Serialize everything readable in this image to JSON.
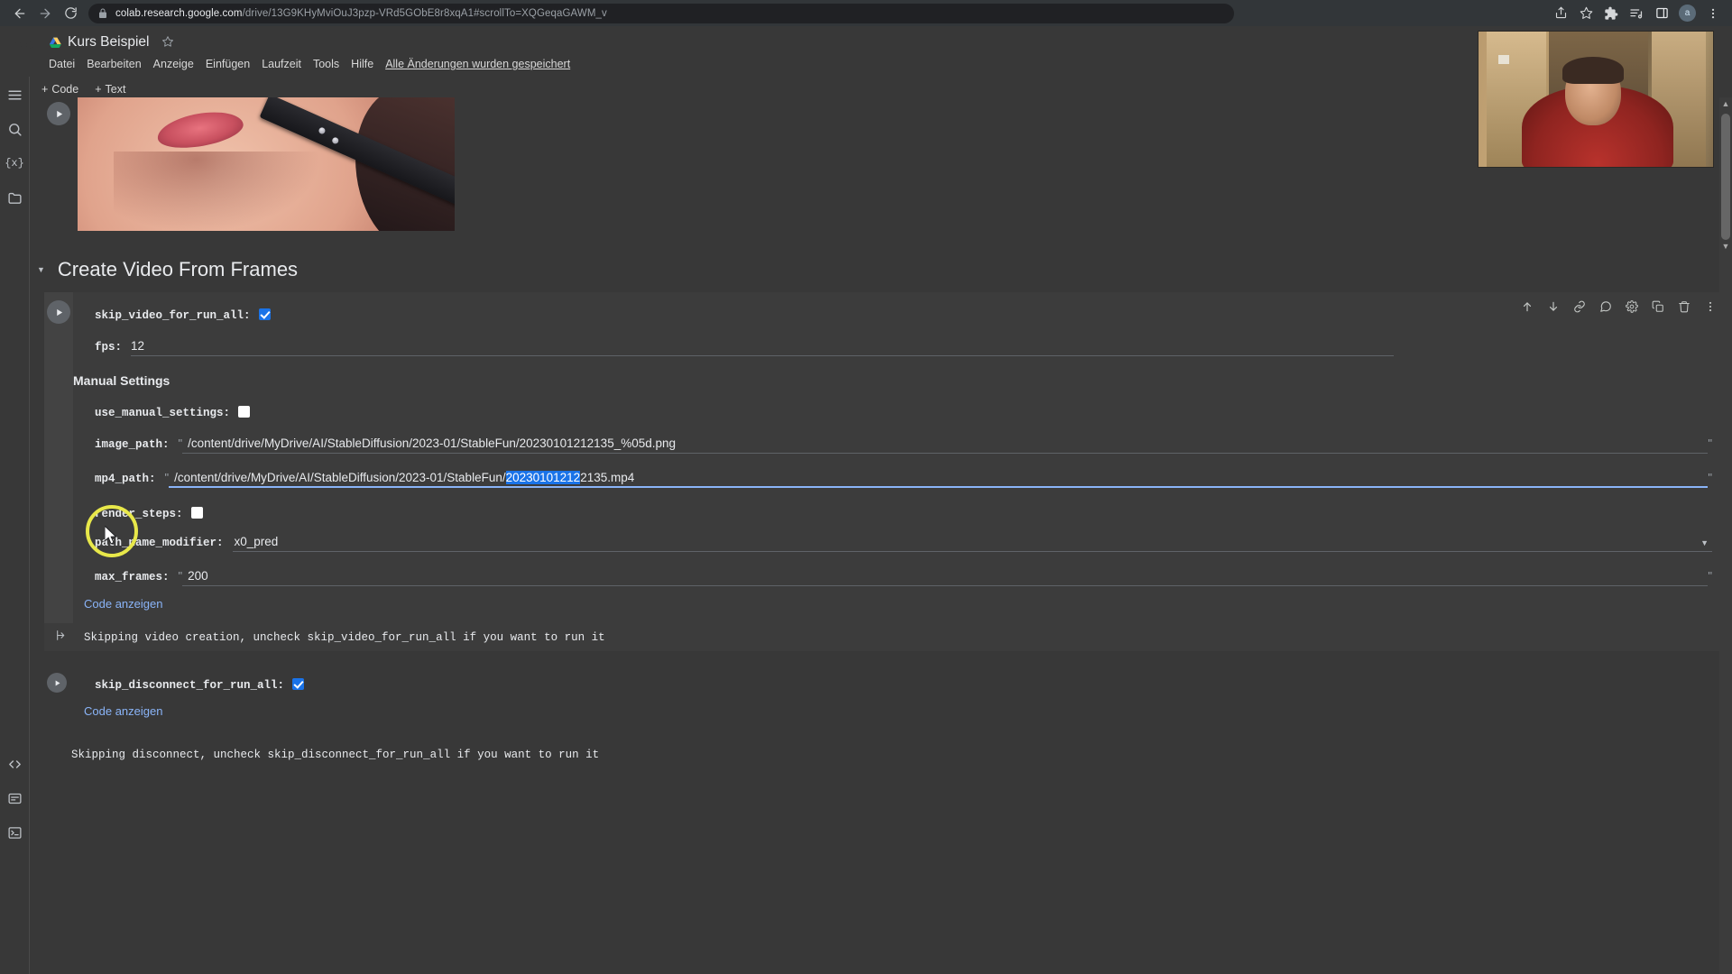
{
  "browser": {
    "back_icon": "back-arrow-icon",
    "forward_icon": "forward-arrow-icon",
    "reload_icon": "reload-icon",
    "url_host": "colab.research.google.com",
    "url_path": "/drive/13G9KHyMviOuJ3pzp-VRd5GObE8r8xqA1#scrollTo=XQGeqaGAWM_v",
    "actions": [
      "share-icon",
      "bookmark-star-icon",
      "extensions-puzzle-icon",
      "reading-list-icon",
      "side-panel-icon"
    ],
    "avatar_letter": "a",
    "menu_icon": "three-dot-menu-icon"
  },
  "colab": {
    "logo": "colab-logo",
    "drive_icon": "google-drive-icon",
    "notebook_title": "Kurs Beispiel",
    "star_icon": "star-icon",
    "menu": [
      "Datei",
      "Bearbeiten",
      "Anzeige",
      "Einfügen",
      "Laufzeit",
      "Tools",
      "Hilfe"
    ],
    "saved_note": "Alle Änderungen wurden gespeichert",
    "toolbar": {
      "add_code": "Code",
      "add_text": "Text",
      "plus": "+"
    },
    "rail": [
      "table-of-contents-icon",
      "search-icon",
      "variables-icon",
      "files-folder-icon",
      "code-snippets-icon",
      "command-palette-icon",
      "terminal-icon"
    ]
  },
  "section": {
    "collapse_icon": "triangle-collapse-icon",
    "title": "Create Video From Frames"
  },
  "cell": {
    "run_icon": "run-cell-icon",
    "toolbar_icons": [
      "move-cell-up-icon",
      "move-cell-down-icon",
      "link-to-cell-icon",
      "add-comment-icon",
      "cell-settings-gear-icon",
      "copy-cell-icon",
      "delete-cell-icon",
      "more-options-icon"
    ],
    "show_code_label": "Code anzeigen",
    "fields": {
      "skip_video_for_run_all": {
        "label": "skip_video_for_run_all:",
        "type": "checkbox",
        "checked": true
      },
      "fps": {
        "label": "fps:",
        "type": "number",
        "value": "12"
      },
      "manual_settings_heading": "Manual Settings",
      "use_manual_settings": {
        "label": "use_manual_settings:",
        "type": "checkbox",
        "checked": false
      },
      "image_path": {
        "label": "image_path:",
        "type": "text",
        "quote": "\"",
        "value": "/content/drive/MyDrive/AI/StableDiffusion/2023-01/StableFun/20230101212135_%05d.png"
      },
      "mp4_path": {
        "label": "mp4_path:",
        "type": "text",
        "quote": "\"",
        "value_before": "/content/drive/MyDrive/AI/StableDiffusion/2023-01/StableFun/",
        "value_selected": "20230101212",
        "value_after": "2135.mp4",
        "focused": true
      },
      "render_steps": {
        "label": "render_steps:",
        "type": "checkbox",
        "checked": false
      },
      "path_name_modifier": {
        "label": "path_name_modifier:",
        "type": "select",
        "value": "x0_pred",
        "caret": "chevron-down-icon"
      },
      "max_frames": {
        "label": "max_frames:",
        "type": "text",
        "quote": "\"",
        "value": "200"
      }
    },
    "output": {
      "icon": "output-arrow-icon",
      "text": "Skipping video creation, uncheck skip_video_for_run_all if you want to run it"
    }
  },
  "cell2": {
    "run_icon": "run-cell-icon",
    "field": {
      "label": "skip_disconnect_for_run_all:",
      "type": "checkbox",
      "checked": true
    },
    "show_code_label": "Code anzeigen",
    "output_text": "Skipping disconnect, uncheck skip_disconnect_for_run_all if you want to run it"
  },
  "annotation": {
    "highlight_ring": "yellow-highlight-circle",
    "cursor": "mouse-cursor"
  },
  "webcam": {
    "label": "webcam-overlay"
  },
  "colors": {
    "accent_blue": "#1a73e8",
    "link_blue": "#8ab4f8",
    "bg": "#383838",
    "cell_bg": "#3c3c3c",
    "highlight_yellow": "#e8e84a"
  }
}
